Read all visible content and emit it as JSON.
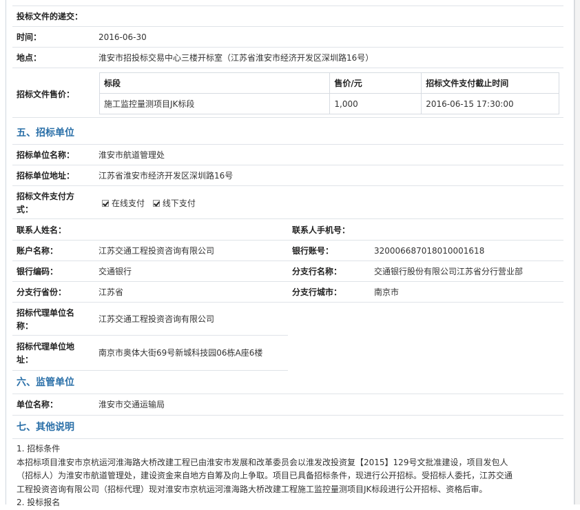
{
  "submission": {
    "heading": "投标文件的递交：",
    "time_label": "时间：",
    "time_value": "2016-06-30",
    "location_label": "地点：",
    "location_value": "淮安市招投标交易中心三楼开标室（江苏省淮安市经济开发区深圳路16号）"
  },
  "price": {
    "label": "招标文件售价：",
    "headers": [
      "标段",
      "售价/元",
      "招标文件支付截止时间"
    ],
    "rows": [
      [
        "施工监控量测项目JK标段",
        "1,000",
        "2016-06-15 17:30:00"
      ]
    ]
  },
  "section5": {
    "title": "五、招标单位",
    "name_label": "招标单位名称：",
    "name_value": "淮安市航道管理处",
    "address_label": "招标单位地址：",
    "address_value": "江苏省淮安市经济开发区深圳路16号",
    "payment_label_1": "招标文件支付方",
    "payment_label_2": "式：",
    "online_label": "在线支付",
    "offline_label": "线下支付",
    "contact_label": "联系人姓名：",
    "contact_value": "",
    "mobile_label": "联系人手机号：",
    "mobile_value": "",
    "account_name_label": "账户名称：",
    "account_name_value": "江苏交通工程投资咨询有限公司",
    "bank_account_label": "银行账号：",
    "bank_account_value": "320006687018010001618",
    "bank_code_label": "银行编码：",
    "bank_code_value": "交通银行",
    "branch_name_label": "分支行名称：",
    "branch_name_value": "交通银行股份有限公司江苏省分行营业部",
    "branch_province_label": "分支行省份：",
    "branch_province_value": "江苏省",
    "branch_city_label": "分支行城市：",
    "branch_city_value": "南京市",
    "agent_name_label_1": "招标代理单位名",
    "agent_name_label_2": "称：",
    "agent_name_value": "江苏交通工程投资咨询有限公司",
    "agent_address_label_1": "招标代理单位地",
    "agent_address_label_2": "址：",
    "agent_address_value": "南京市奥体大街69号新城科技园06栋A座6楼"
  },
  "section6": {
    "title": "六、监管单位",
    "unit_label": "单位名称：",
    "unit_value": "淮安市交通运输局"
  },
  "section7": {
    "title": "七、其他说明",
    "item1_title": "1. 招标条件",
    "line1": "本招标项目淮安市京杭运河淮海路大桥改建工程已由淮安市发展和改革委员会以淮发改投资复【2015】129号文批准建设，项目发包人",
    "line2": "（招标人）为淮安市航道管理处，建设资金来自地方自筹及向上争取。项目已具备招标条件，现进行公开招标。受招标人委托，江苏交通",
    "line3": "工程投资咨询有限公司（招标代理）现对淮安市京杭运河淮海路大桥改建工程施工监控量测项目JK标段进行公开招标、资格后审。",
    "item2_title": "2. 投标报名"
  }
}
